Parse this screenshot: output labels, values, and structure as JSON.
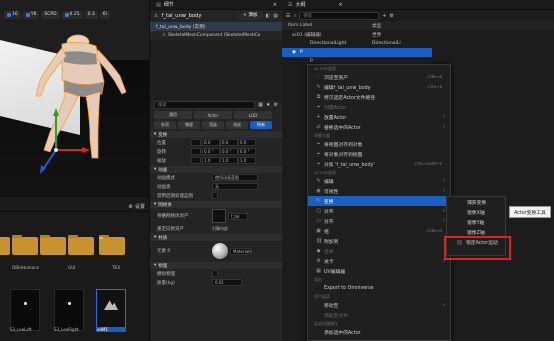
{
  "viewport": {
    "toolbar": [
      "16",
      "Y8",
      "SCPD",
      "0.25",
      "0.3",
      "6l"
    ]
  },
  "content_browser": {
    "settings_label": "设置",
    "folders": [
      "",
      "",
      "",
      "DBlaHumans",
      "GUI",
      "TEX"
    ],
    "assets": [
      "S3_LeeLeft",
      "S3_LeeRight",
      "eeM1"
    ]
  },
  "details": {
    "tab": "细节",
    "object_name": "f_tal_unw_body",
    "add_label": "+ 添加",
    "component_row": "f_tal_unw_body (实例)",
    "mesh_component": "SkeletalMeshComponent (SkeletalMeshCo",
    "search_placeholder": "搜索",
    "filter_tabs_row1": [
      "通用",
      "Actor",
      "LOD"
    ],
    "filter_tabs_row2": [
      "杂项",
      "物理",
      "渲染",
      "流送",
      "所有"
    ],
    "transform_header": "变换",
    "transform_rows": [
      {
        "label": "位置",
        "x": "0.0",
        "y": "0.0",
        "z": "0.0"
      },
      {
        "label": "旋转",
        "x": "0.0 °",
        "y": "0.0 °",
        "z": "0.0 °"
      },
      {
        "label": "缩放",
        "x": "1.0",
        "y": "1.0",
        "z": "1.0"
      }
    ],
    "anim_header": "动画",
    "anim_rows": [
      {
        "label": "动画模式",
        "value": "使用动画蓝图"
      },
      {
        "label": "动画类",
        "value": "无"
      },
      {
        "label": "禁用后期处理蓝图",
        "value": ""
      }
    ],
    "mesh_header": "网格体",
    "mesh_rows": [
      {
        "label": "骨骼网格体资产",
        "value": "f_tal"
      },
      {
        "label": "重定向原资产",
        "value": "引擎内部"
      }
    ],
    "material_header": "材质",
    "material_rows": [
      {
        "label": "元素 0",
        "value": "Materials"
      }
    ],
    "physics_header": "物理",
    "physics_rows": [
      {
        "label": "模拟物理",
        "value": ""
      },
      {
        "label": "质量(kg)",
        "value": "0.01"
      }
    ]
  },
  "outliner": {
    "tab": "大纲",
    "search_placeholder": "搜索",
    "col_item": "Item Label",
    "col_type": "类型",
    "tree": [
      {
        "label": "sc01 (编辑器)",
        "type": "世界"
      },
      {
        "label": "DirectionalLight",
        "type": "DirectionalLi"
      },
      {
        "label": "f_tal_unw_body",
        "type": ""
      },
      {
        "label": "P",
        "type": ""
      },
      {
        "label": "P",
        "type": ""
      },
      {
        "label": "S",
        "type": ""
      }
    ]
  },
  "context_menu": {
    "items": [
      {
        "kind": "section",
        "label": "ACTOR选项"
      },
      {
        "kind": "item",
        "icon": "◦",
        "label": "浏览至资产",
        "shortcut": "CTRL+B"
      },
      {
        "kind": "item",
        "icon": "✎",
        "label": "编辑f_tal_unw_body",
        "shortcut": "CTRL+E"
      },
      {
        "kind": "item",
        "icon": "⧉",
        "label": "拷贝选定Actor文件路径",
        "shortcut": ""
      },
      {
        "kind": "item",
        "icon": "⌖",
        "label": "创建Actor",
        "shortcut": "",
        "disabled": true
      },
      {
        "kind": "item",
        "icon": "+",
        "label": "放置Actor",
        "shortcut": "",
        "arrow": true
      },
      {
        "kind": "item",
        "icon": "⇄",
        "label": "替换选中的Actor",
        "shortcut": "",
        "arrow": true
      },
      {
        "kind": "section",
        "label": "场景大纲"
      },
      {
        "kind": "item",
        "icon": "⌖",
        "label": "将视图对齐到对象",
        "shortcut": ""
      },
      {
        "kind": "item",
        "icon": "⌖",
        "label": "将对象对齐到视图",
        "shortcut": ""
      },
      {
        "kind": "item",
        "icon": "⌖",
        "label": "对焦 'f_tal_unw_body'",
        "shortcut": "CTRL+SHIFT+F"
      },
      {
        "kind": "section",
        "label": "ACTOR选项"
      },
      {
        "kind": "item",
        "icon": "✎",
        "label": "编辑",
        "shortcut": "",
        "arrow": true
      },
      {
        "kind": "item",
        "icon": "◉",
        "label": "可视性",
        "shortcut": "",
        "arrow": true
      },
      {
        "kind": "item",
        "icon": "⇱",
        "label": "变换",
        "shortcut": "",
        "arrow": true,
        "highlight": true
      },
      {
        "kind": "item",
        "icon": "◫",
        "label": "对齐",
        "shortcut": "",
        "arrow": true
      },
      {
        "kind": "item",
        "icon": "▭",
        "label": "对齐",
        "shortcut": "",
        "arrow": true
      },
      {
        "kind": "item",
        "icon": "▣",
        "label": "组",
        "shortcut": "CTRL+G"
      },
      {
        "kind": "item",
        "icon": "⛓",
        "label": "附加到",
        "shortcut": "",
        "arrow": true
      },
      {
        "kind": "item",
        "icon": "◆",
        "label": "合并",
        "shortcut": "",
        "disabled": true
      },
      {
        "kind": "item",
        "icon": "⚙",
        "label": "关卡",
        "shortcut": "",
        "arrow": true
      },
      {
        "kind": "item",
        "icon": "▦",
        "label": "UV编辑器",
        "shortcut": ""
      },
      {
        "kind": "section",
        "label": "导出"
      },
      {
        "kind": "item",
        "icon": "",
        "label": "Export to Omniverse",
        "shortcut": ""
      },
      {
        "kind": "section",
        "label": "资产选项"
      },
      {
        "kind": "item",
        "icon": "",
        "label": "移动至",
        "shortcut": "",
        "arrow": true
      },
      {
        "kind": "item",
        "icon": "",
        "label": "添加至文件",
        "shortcut": "",
        "disabled": true
      },
      {
        "kind": "section",
        "label": "层对比器操作"
      },
      {
        "kind": "item",
        "icon": "",
        "label": "添加选中的Actor",
        "shortcut": ""
      }
    ]
  },
  "submenu": {
    "items": [
      "捕获变换",
      "镜像X轴",
      "镜像Y轴",
      "镜像Z轴",
      "锁定Actor运动"
    ]
  },
  "tooltip": "Actor变换工具"
}
